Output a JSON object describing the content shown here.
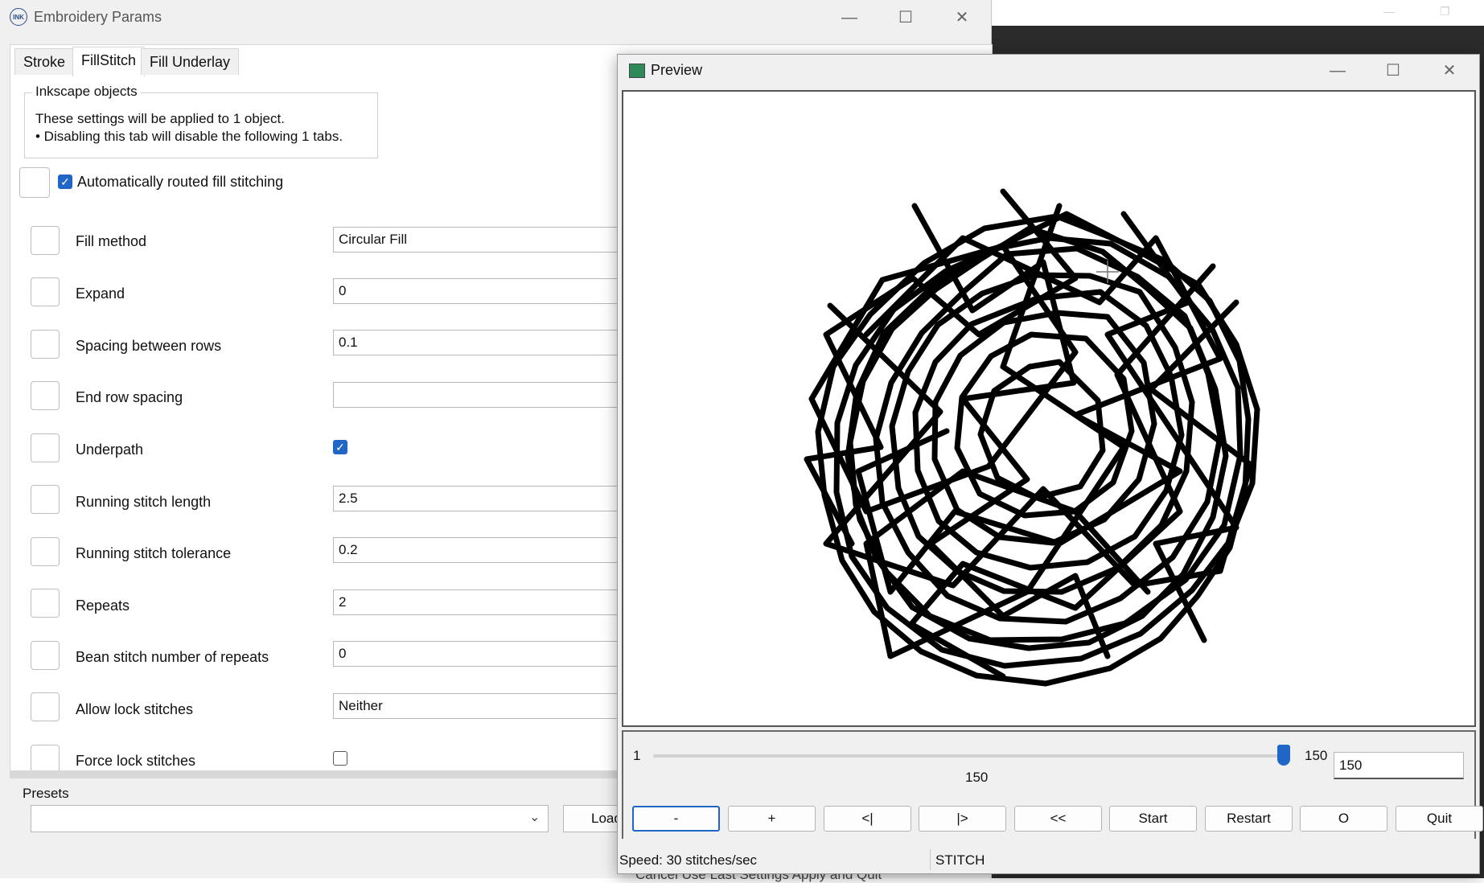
{
  "main_window": {
    "title": "Embroidery Params",
    "logo_text": "INK"
  },
  "tabs": [
    {
      "label": "Stroke"
    },
    {
      "label": "FillStitch"
    },
    {
      "label": "Fill Underlay"
    }
  ],
  "group": {
    "legend": "Inkscape objects",
    "line1": "These settings will be applied to 1 object.",
    "line2": "• Disabling this tab will disable the following 1 tabs."
  },
  "auto_fill": {
    "label": "Automatically routed fill stitching",
    "checked": true
  },
  "params": [
    {
      "label": "Fill method",
      "value": "Circular Fill",
      "kind": "select"
    },
    {
      "label": "Expand",
      "value": "0",
      "kind": "text"
    },
    {
      "label": "Spacing between rows",
      "value": "0.1",
      "kind": "text"
    },
    {
      "label": "End row spacing",
      "value": "",
      "kind": "text"
    },
    {
      "label": "Underpath",
      "checked": true,
      "kind": "checkbox"
    },
    {
      "label": "Running stitch length",
      "value": "2.5",
      "kind": "text"
    },
    {
      "label": "Running stitch tolerance",
      "value": "0.2",
      "kind": "text"
    },
    {
      "label": "Repeats",
      "value": "2",
      "kind": "text"
    },
    {
      "label": "Bean stitch number of repeats",
      "value": "0",
      "kind": "text"
    },
    {
      "label": "Allow lock stitches",
      "value": "Neither",
      "kind": "select"
    },
    {
      "label": "Force lock stitches",
      "checked": false,
      "kind": "checkbox"
    }
  ],
  "presets": {
    "label": "Presets",
    "selected": "",
    "load_label": "Load"
  },
  "bottom_buttons": "Cancel    Use Last Settings    Apply and Quit",
  "preview": {
    "title": "Preview",
    "slider": {
      "min": "1",
      "max": "150",
      "current_label": "150",
      "position_fraction": 1.0
    },
    "frame_input": "150",
    "buttons": [
      "-",
      "+",
      "<|",
      "|>",
      "<<",
      "Start",
      "Restart",
      "O",
      "Quit"
    ],
    "status_speed": "Speed: 30 stitches/sec",
    "status_mode": "STITCH"
  },
  "colors": {
    "accent": "#1f66c7",
    "stitch": "#000000",
    "background_app": "#2b2b2b"
  },
  "icons": {
    "minimize": "minimize-icon",
    "maximize": "maximize-icon",
    "close": "close-icon",
    "check": "check-icon",
    "chevron": "chevron-down-icon"
  }
}
